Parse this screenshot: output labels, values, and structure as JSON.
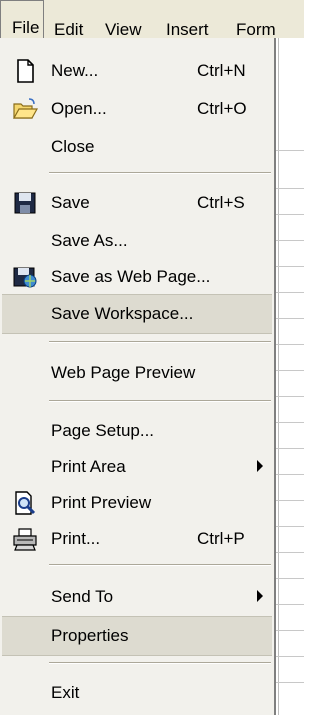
{
  "menubar": {
    "file": "File",
    "edit": "Edit",
    "view": "View",
    "insert": "Insert",
    "format": "Form"
  },
  "menu": {
    "new": {
      "label": "New...",
      "shortcut": "Ctrl+N"
    },
    "open": {
      "label": "Open...",
      "shortcut": "Ctrl+O"
    },
    "close": {
      "label": "Close"
    },
    "save": {
      "label": "Save",
      "shortcut": "Ctrl+S"
    },
    "save_as": {
      "label": "Save As..."
    },
    "save_web": {
      "label": "Save as Web Page..."
    },
    "save_workspace": {
      "label": "Save Workspace..."
    },
    "web_preview": {
      "label": "Web Page Preview"
    },
    "page_setup": {
      "label": "Page Setup..."
    },
    "print_area": {
      "label": "Print Area"
    },
    "print_preview": {
      "label": "Print Preview"
    },
    "print": {
      "label": "Print...",
      "shortcut": "Ctrl+P"
    },
    "send_to": {
      "label": "Send To"
    },
    "properties": {
      "label": "Properties"
    },
    "exit": {
      "label": "Exit"
    }
  },
  "icons": {
    "new": "new-document-icon",
    "open": "open-folder-icon",
    "save": "floppy-disk-icon",
    "save_web": "save-web-page-icon",
    "print_preview": "print-preview-icon",
    "print": "printer-icon"
  },
  "colors": {
    "menu_bg": "#f2f1ec",
    "menubar_bg": "#ece9d8",
    "highlight": "#dddbd0"
  }
}
